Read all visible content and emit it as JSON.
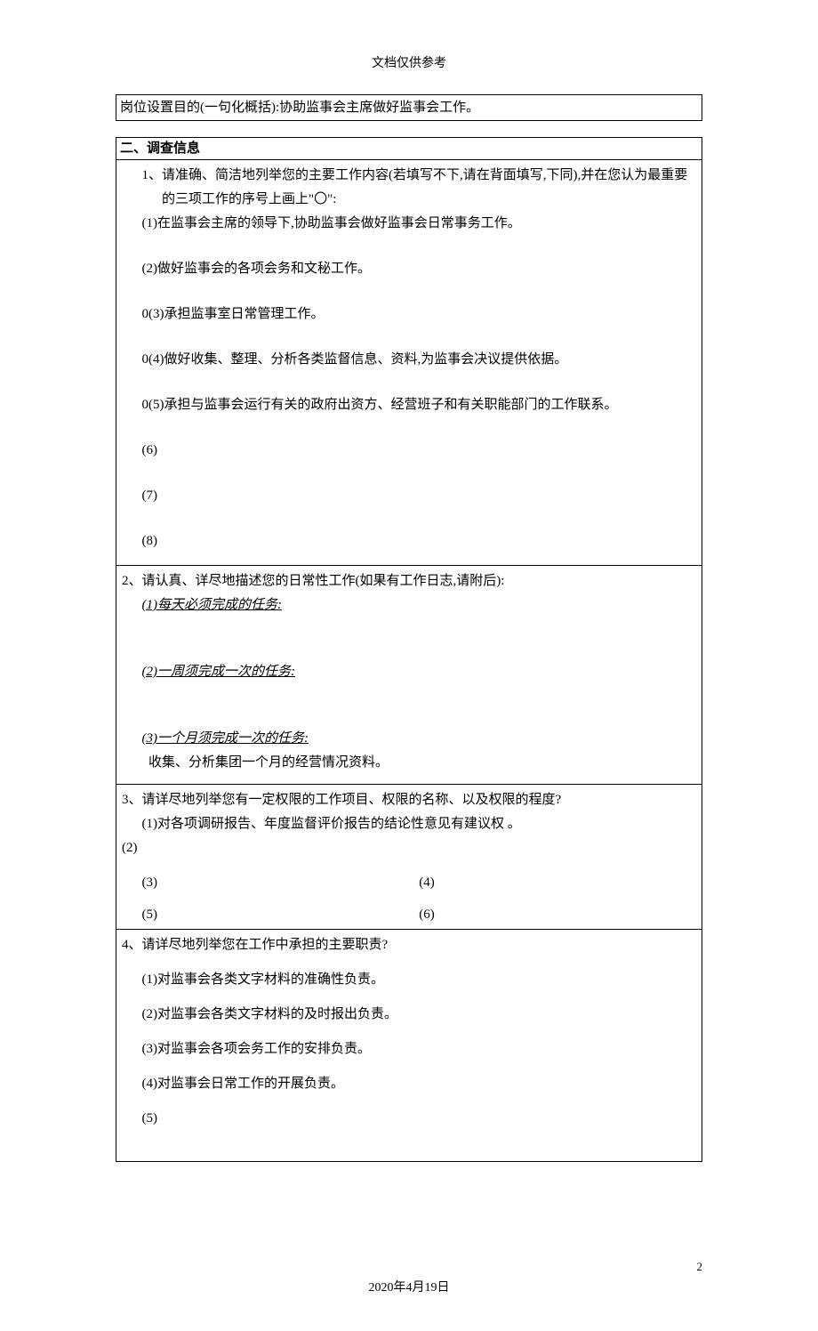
{
  "header_note": "文档仅供参考",
  "goal_box": "岗位设置目的(一句化概括):协助监事会主席做好监事会工作。",
  "section2": {
    "title": "二、调查信息",
    "q1": {
      "prompt_prefix": "1、请准确、简洁地列举您的主要工作内容(若填写不下,请在背面填写,下同),并在您认为最重要的三项工作的序号上画上\"〇\":",
      "items": {
        "i1": "(1)在监事会主席的领导下,协助监事会做好监事会日常事务工作。",
        "i2": "(2)做好监事会的各项会务和文秘工作。",
        "i3": "0(3)承担监事室日常管理工作。",
        "i4": "0(4)做好收集、整理、分析各类监督信息、资料,为监事会决议提供依据。",
        "i5": "0(5)承担与监事会运行有关的政府出资方、经营班子和有关职能部门的工作联系。",
        "i6": "(6)",
        "i7": "(7)",
        "i8": "(8)"
      }
    },
    "q2": {
      "prompt": "2、请认真、详尽地描述您的日常性工作(如果有工作日志,请附后):",
      "sub1_label": "(1)每天必须完成的任务:",
      "sub2_label": "(2)一周须完成一次的任务:",
      "sub3_label": "(3)一个月须完成一次的任务:",
      "sub3_content": "收集、分析集团一个月的经营情况资料。"
    },
    "q3": {
      "prompt": "3、请详尽地列举您有一定权限的工作项目、权限的名称、以及权限的程度?",
      "i1": "(1)对各项调研报告、年度监督评价报告的结论性意见有建议权 。",
      "i2": "(2)",
      "i3": "(3)",
      "i4": "(4)",
      "i5": "(5)",
      "i6": "(6)"
    },
    "q4": {
      "prompt": "4、请详尽地列举您在工作中承担的主要职责?",
      "i1": "(1)对监事会各类文字材料的准确性负责。",
      "i2": "(2)对监事会各类文字材料的及时报出负责。",
      "i3": "(3)对监事会各项会务工作的安排负责。",
      "i4": "(4)对监事会日常工作的开展负责。",
      "i5": "(5)"
    }
  },
  "footer_date": "2020年4月19日",
  "footer_page": "2"
}
